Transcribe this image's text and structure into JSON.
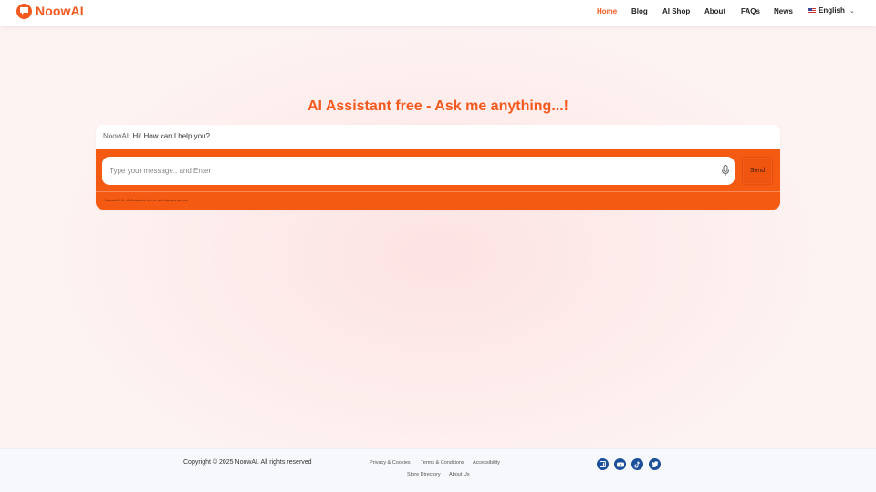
{
  "header": {
    "logo_text": "NoowAI",
    "nav": [
      {
        "label": "Home",
        "active": true
      },
      {
        "label": "Blog"
      },
      {
        "label": "AI Shop"
      },
      {
        "label": "About"
      },
      {
        "label": "FAQs"
      },
      {
        "label": "News"
      }
    ],
    "language": "English"
  },
  "main": {
    "title": "AI Assistant free - Ask me anything...!",
    "chat": {
      "bot_name": "NoowAI:",
      "greeting": "Hi! How can I help you?",
      "input_placeholder": "Type your message.. and Enter",
      "send_label": "Send",
      "disclaimer": "NoowAI 2.0 - AI Assistant is free and always secure"
    }
  },
  "footer": {
    "copyright": "Copyright © 2025 NoowAI. All rights reserved",
    "links": [
      "Privacy & Cookies",
      "Terms & Conditions",
      "Accessibility",
      "Store Directory",
      "About Us"
    ],
    "social": [
      "facebook-icon",
      "youtube-icon",
      "tiktok-icon",
      "twitter-icon"
    ]
  },
  "colors": {
    "accent": "#f25a1f",
    "input_bar": "#f55a12",
    "social_icon": "#1b4f9b"
  }
}
